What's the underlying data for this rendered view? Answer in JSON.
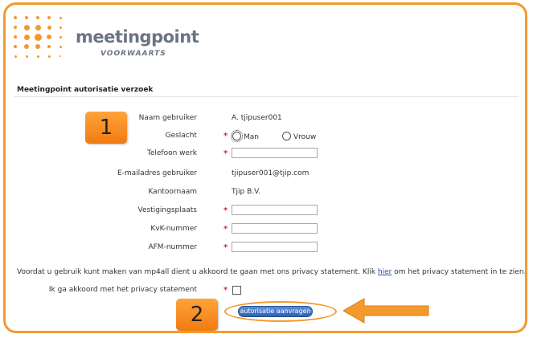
{
  "brand": {
    "name": "meetingpoint",
    "tagline": "VOORWAARTS",
    "accent_color": "#f29a2e",
    "text_color": "#6a7484"
  },
  "form": {
    "title": "Meetingpoint autorisatie verzoek",
    "fields": {
      "naam": {
        "label": "Naam gebruiker",
        "value": "A. tjipuser001"
      },
      "geslacht": {
        "label": "Geslacht",
        "required_mark": "*",
        "options": [
          "Man",
          "Vrouw"
        ]
      },
      "telefoon": {
        "label": "Telefoon werk",
        "required_mark": "*",
        "value": ""
      },
      "email": {
        "label": "E-mailadres gebruiker",
        "value": "tjipuser001@tjip.com"
      },
      "kantoor": {
        "label": "Kantoornaam",
        "value": "Tjip B.V."
      },
      "vestiging": {
        "label": "Vestigingsplaats",
        "required_mark": "*",
        "value": ""
      },
      "kvk": {
        "label": "KvK-nummer",
        "required_mark": "*",
        "value": ""
      },
      "afm": {
        "label": "AFM-nummer",
        "required_mark": "*",
        "value": ""
      }
    },
    "privacy": {
      "text_before": "Voordat u gebruik kunt maken van mp4all dient u akkoord te gaan met ons privacy statement. Klik ",
      "link": "hier",
      "text_after": " om het privacy statement in te zien.",
      "agree_label": "Ik ga akkoord met het privacy statement",
      "required_mark": "*"
    },
    "submit_label": "autorisatie aanvragen"
  },
  "annotations": {
    "badge1": "1",
    "badge2": "2",
    "color": "#f29a2e"
  }
}
